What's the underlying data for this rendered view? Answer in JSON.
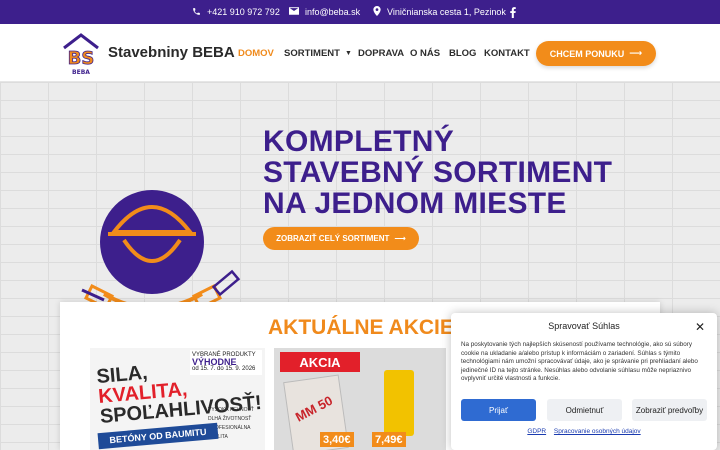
{
  "topbar": {
    "phone": "+421 910 972 792",
    "email": "info@beba.sk",
    "address": "Viničnianska cesta 1, Pezinok",
    "phone_icon": "phone-icon",
    "email_icon": "envelope-icon",
    "address_icon": "map-pin-icon",
    "social_icon": "facebook-icon"
  },
  "header": {
    "logo_text": "BS",
    "logo_sub": "BEBA",
    "brand": "Stavebniny BEBA",
    "nav": [
      {
        "label": "DOMOV",
        "active": true
      },
      {
        "label": "SORTIMENT",
        "dropdown": true
      },
      {
        "label": "DOPRAVA"
      },
      {
        "label": "O NÁS"
      },
      {
        "label": "BLOG"
      },
      {
        "label": "KONTAKT"
      }
    ],
    "cta": "CHCEM PONUKU"
  },
  "hero": {
    "title_lines": [
      "KOMPLETNÝ",
      "STAVEBNÝ SORTIMENT",
      "NA JEDNOM MIESTE"
    ],
    "button": "ZOBRAZIŤ CELÝ SORTIMENT"
  },
  "promo": {
    "title": "AKTUÁLNE AKCIE",
    "card1": {
      "line1": "SILA,",
      "line2": "KVALITA,",
      "line3": "SPOĽAHLIVOSŤ!",
      "badge_top": "VYBRANÉ PRODUKTY",
      "badge_main": "VÝHODNE",
      "badge_dates": "od 15. 7. do 15. 9. 2026",
      "bullets": [
        "VYSOKÁ PEVNOSŤ",
        "DLHÁ ŽIVOTNOSŤ",
        "PROFESIONÁLNA KVALITA"
      ],
      "ribbon": "BETÓNY OD BAUMITU"
    },
    "card2": {
      "badge": "AKCIA",
      "product1": "MM 50",
      "price1": "3,40€",
      "price2": "7,49€"
    }
  },
  "cookie": {
    "title": "Spravovať Súhlas",
    "text": "Na poskytovanie tých najlepších skúseností používame technológie, ako sú súbory cookie na ukladanie a/alebo prístup k informáciám o zariadení. Súhlas s týmito technológiami nám umožní spracovávať údaje, ako je správanie pri prehliadaní alebo jedinečné ID na tejto stránke. Nesúhlas alebo odvolanie súhlasu môže nepriaznivo ovplyvniť určité vlastnosti a funkcie.",
    "accept": "Prijať",
    "deny": "Odmietnuť",
    "preferences": "Zobraziť predvoľby",
    "link1": "GDPR",
    "link2": "Spracovanie osobných údajov"
  },
  "colors": {
    "primary_purple": "#3d1f8c",
    "accent_orange": "#f28c1a",
    "cookie_blue": "#2f6bd2"
  }
}
